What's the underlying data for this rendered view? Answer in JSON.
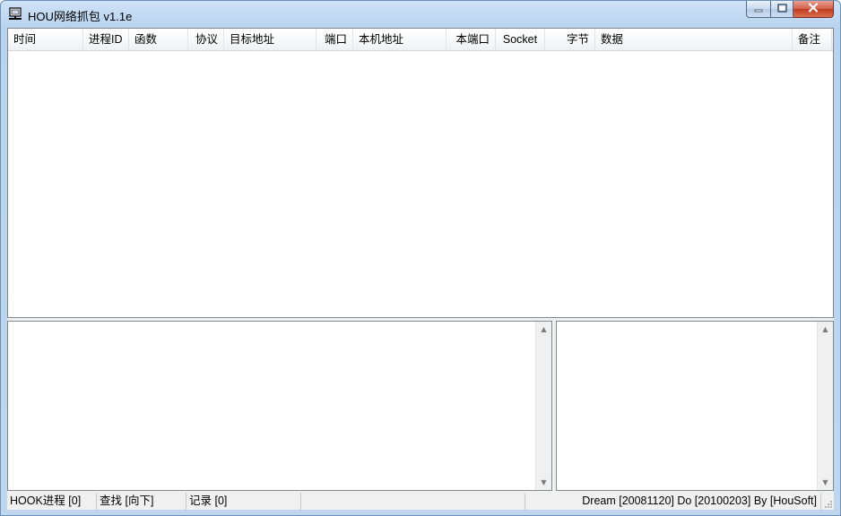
{
  "window": {
    "title": "HOU网络抓包 v1.1e",
    "icon": "network-computer-icon"
  },
  "caption_buttons": {
    "minimize": "minimize-icon",
    "maximize": "maximize-icon",
    "close": "close-icon"
  },
  "list": {
    "columns": [
      "时间",
      "进程ID",
      "函数",
      "协议",
      "目标地址",
      "端口",
      "本机地址",
      "本端口",
      "Socket",
      "字节",
      "数据",
      "备注"
    ],
    "rows": []
  },
  "statusbar": {
    "hook": "HOOK进程 [0]",
    "find": "查找 [向下]",
    "records": "记录 [0]",
    "empty": "",
    "credits": "Dream [20081120]  Do [20100203]  By [HouSoft]"
  }
}
